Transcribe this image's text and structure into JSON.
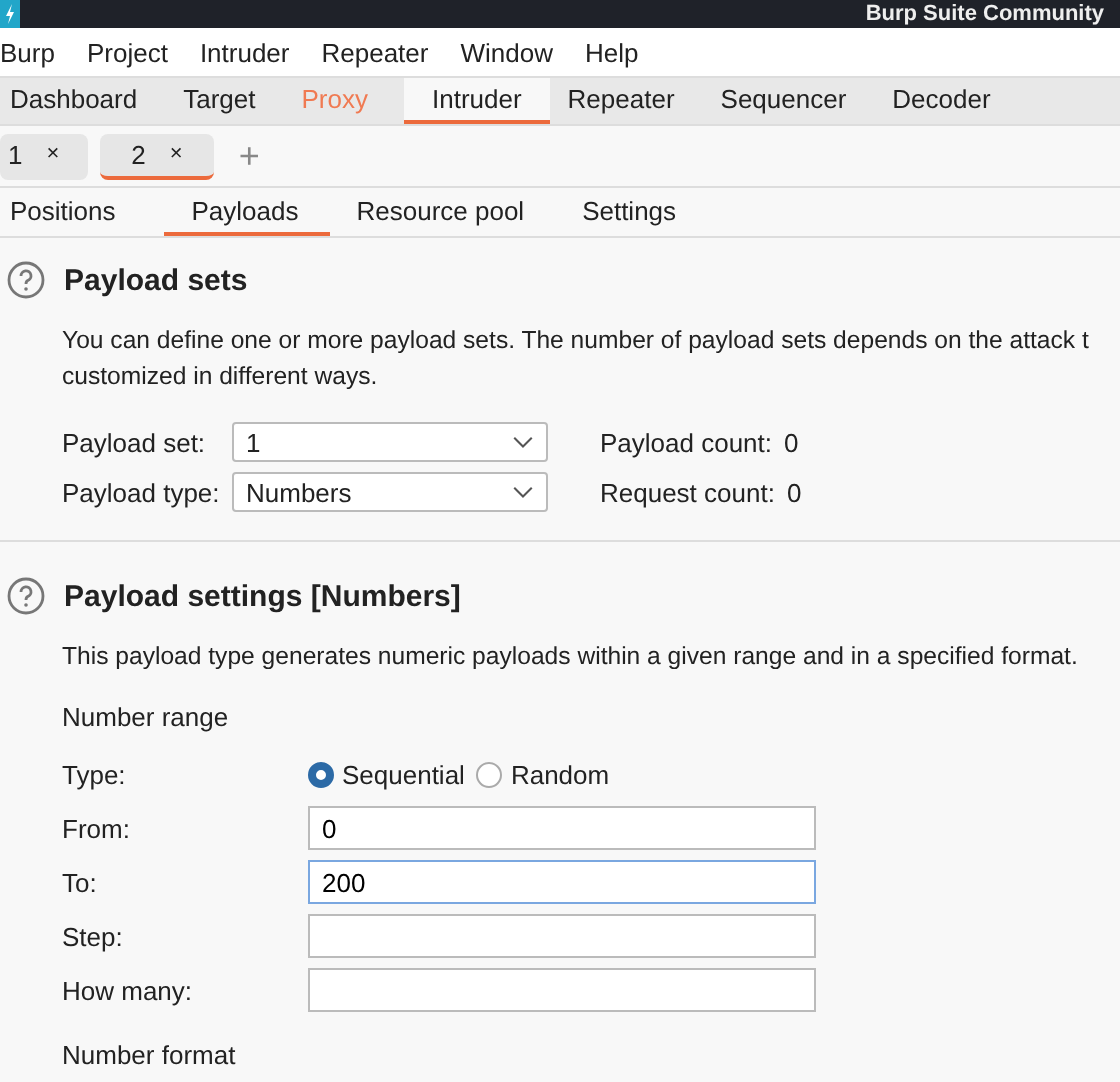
{
  "window": {
    "title": "Burp Suite Community"
  },
  "menu": [
    "Burp",
    "Project",
    "Intruder",
    "Repeater",
    "Window",
    "Help"
  ],
  "main_tabs": [
    {
      "label": "Dashboard",
      "selected": false,
      "highlighted": false
    },
    {
      "label": "Target",
      "selected": false,
      "highlighted": false
    },
    {
      "label": "Proxy",
      "selected": false,
      "highlighted": true
    },
    {
      "label": "Intruder",
      "selected": true,
      "highlighted": false
    },
    {
      "label": "Repeater",
      "selected": false,
      "highlighted": false
    },
    {
      "label": "Sequencer",
      "selected": false,
      "highlighted": false
    },
    {
      "label": "Decoder",
      "selected": false,
      "highlighted": false
    }
  ],
  "attack_tabs": [
    {
      "label": "1",
      "close": "×",
      "selected": false
    },
    {
      "label": "2",
      "close": "×",
      "selected": true
    }
  ],
  "add_tab": "+",
  "sub_tabs": [
    {
      "label": "Positions",
      "selected": false
    },
    {
      "label": "Payloads",
      "selected": true
    },
    {
      "label": "Resource pool",
      "selected": false
    },
    {
      "label": "Settings",
      "selected": false
    }
  ],
  "payload_sets": {
    "title": "Payload sets",
    "description": "You can define one or more payload sets. The number of payload sets depends on the attack t\ncustomized in different ways.",
    "rows": [
      {
        "label": "Payload set:",
        "value": "1",
        "info_label": "Payload count:",
        "info_value": "0"
      },
      {
        "label": "Payload type:",
        "value": "Numbers",
        "info_label": "Request count:",
        "info_value": "0"
      }
    ]
  },
  "payload_settings": {
    "title": "Payload settings [Numbers]",
    "description": "This payload type generates numeric payloads within a given range and in a specified format.",
    "group": "Number range",
    "type_label": "Type:",
    "type_options": [
      {
        "label": "Sequential",
        "selected": true
      },
      {
        "label": "Random",
        "selected": false
      }
    ],
    "fields": [
      {
        "label": "From:",
        "value": "0",
        "focused": false
      },
      {
        "label": "To:",
        "value": "200",
        "focused": true
      },
      {
        "label": "Step:",
        "focused": false
      },
      {
        "label": "How many:",
        "focused": false
      }
    ],
    "next_group": "Number format"
  }
}
